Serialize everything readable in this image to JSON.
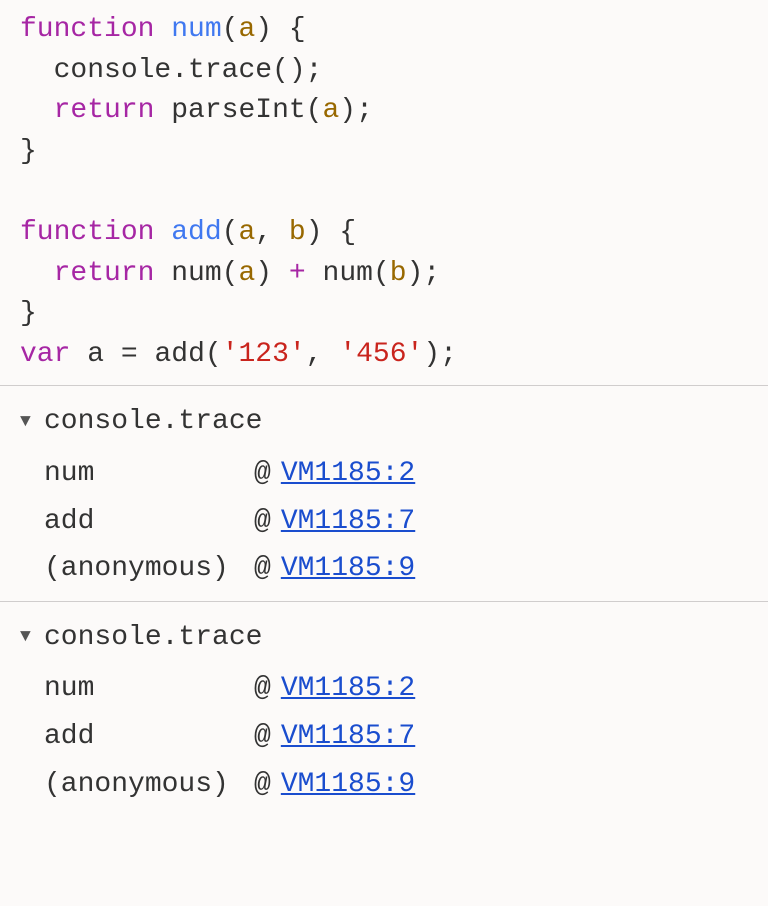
{
  "code": {
    "kw_function": "function",
    "kw_return": "return",
    "kw_var": "var",
    "func_num": "num",
    "func_add": "add",
    "param_a": "a",
    "param_b": "b",
    "console_trace": "console.trace();",
    "parseInt": "parseInt",
    "var_a": "a",
    "eq": " = ",
    "plus": " + ",
    "str_123": "'123'",
    "str_456": "'456'",
    "open_paren": "(",
    "close_paren": ")",
    "open_brace": " {",
    "close_brace": "}",
    "comma": ", ",
    "semicolon": ";",
    "indent": "  "
  },
  "traces": [
    {
      "title": "console.trace",
      "rows": [
        {
          "func": "num",
          "link": "VM1185:2"
        },
        {
          "func": "add",
          "link": "VM1185:7"
        },
        {
          "func": "(anonymous)",
          "link": "VM1185:9"
        }
      ]
    },
    {
      "title": "console.trace",
      "rows": [
        {
          "func": "num",
          "link": "VM1185:2"
        },
        {
          "func": "add",
          "link": "VM1185:7"
        },
        {
          "func": "(anonymous)",
          "link": "VM1185:9"
        }
      ]
    }
  ],
  "at_symbol": "@"
}
